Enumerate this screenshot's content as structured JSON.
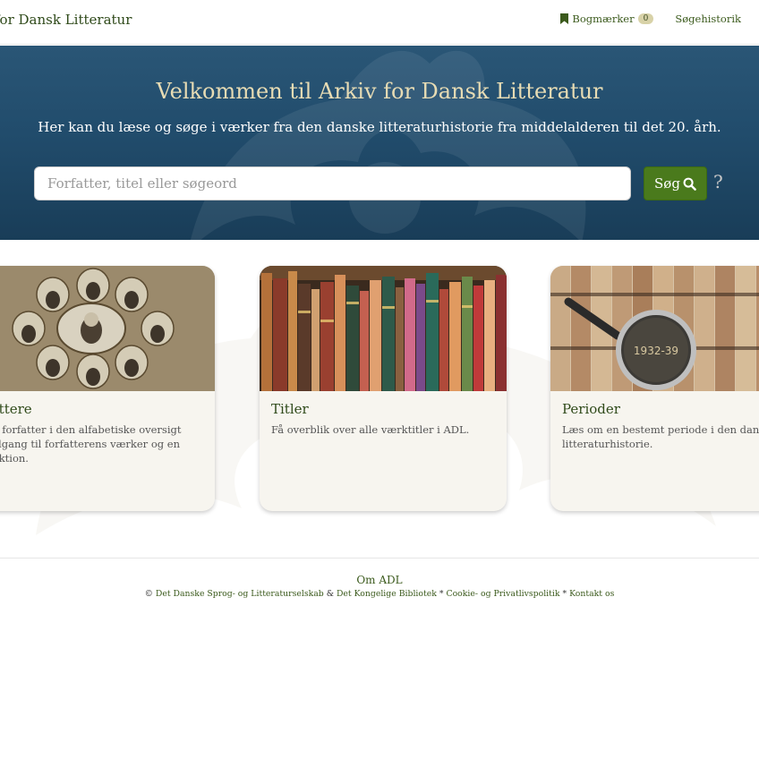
{
  "navbar": {
    "brand": "for Dansk Litteratur",
    "bookmarks_label": "Bogmærker",
    "bookmarks_count": "0",
    "history_label": "Søgehistorik"
  },
  "hero": {
    "title": "Velkommen til Arkiv for Dansk Litteratur",
    "subtitle": "Her kan du læse og søge i værker fra den danske litteraturhistorie fra middelalderen til det 20. årh.",
    "search_placeholder": "Forfatter, titel eller søgeord",
    "search_button": "Søg",
    "help_label": "?"
  },
  "cards": [
    {
      "title": "rfattere",
      "lines": [
        "l en forfatter i den alfabetiske oversigt",
        "å adgang til forfatterens værker og en",
        "oduktion."
      ]
    },
    {
      "title": "Titler",
      "lines": [
        "Få overblik over alle værktitler i ADL."
      ]
    },
    {
      "title": "Perioder",
      "lines": [
        "Læs om en bestemt periode i den dansk",
        "litteraturhistorie."
      ]
    }
  ],
  "card_image_labels": {
    "periods_magnifier_text": "1932-39"
  },
  "footer": {
    "about": "Om ADL",
    "copyright": "©",
    "link_dsl": "Det Danske Sprog- og Litteraturselskab",
    "amp": "&",
    "link_kb": "Det Kongelige Bibliotek",
    "sep": "*",
    "link_cookie": "Cookie- og Privatlivspolitik",
    "link_contact": "Kontakt os"
  },
  "colors": {
    "accent_green": "#4a7a1c",
    "link_green": "#3b5a1c",
    "hero_blue": "#214c6c",
    "hero_title": "#e7dcb4",
    "card_bg": "#f7f5ef"
  },
  "icons": {
    "bookmark": "bookmark-icon",
    "search": "search-icon"
  }
}
